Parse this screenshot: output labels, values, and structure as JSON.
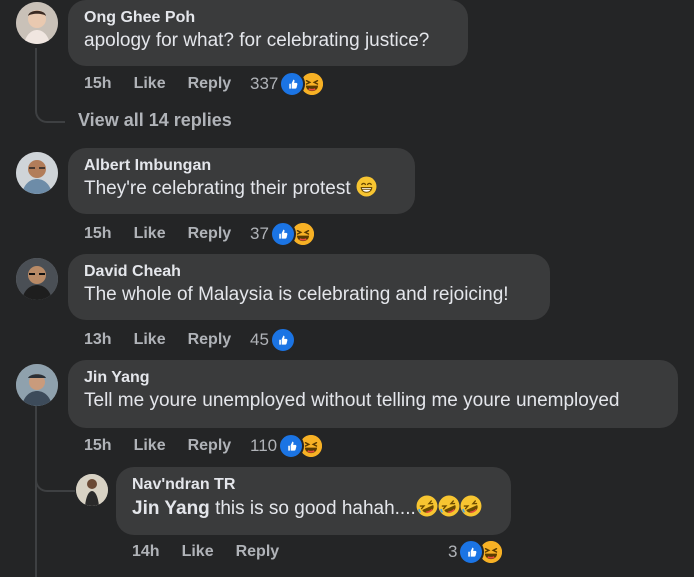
{
  "comments": [
    {
      "author": "Ong Ghee Poh",
      "text": "apology for what? for celebrating justice?",
      "time": "15h",
      "like_label": "Like",
      "reply_label": "Reply",
      "reaction_count": "337",
      "reactions": [
        "like-icon",
        "haha-icon"
      ]
    },
    {
      "author": "Albert Imbungan",
      "text": "They're celebrating their protest",
      "text_emoji": "grinning-face-icon",
      "time": "15h",
      "like_label": "Like",
      "reply_label": "Reply",
      "reaction_count": "37",
      "reactions": [
        "like-icon",
        "haha-icon"
      ]
    },
    {
      "author": "David Cheah",
      "text": "The whole of Malaysia is celebrating and rejoicing!",
      "time": "13h",
      "like_label": "Like",
      "reply_label": "Reply",
      "reaction_count": "45",
      "reactions": [
        "like-icon"
      ]
    },
    {
      "author": "Jin Yang",
      "text": "Tell me youre unemployed without telling me youre unemployed",
      "time": "15h",
      "like_label": "Like",
      "reply_label": "Reply",
      "reaction_count": "110",
      "reactions": [
        "like-icon",
        "haha-icon"
      ]
    }
  ],
  "view_replies": "View all 14 replies",
  "reply": {
    "author": "Nav'ndran TR",
    "mention": "Jin Yang",
    "text": " this is so good hahah....",
    "text_emojis": [
      "rolling-laughing-icon",
      "rolling-laughing-icon",
      "rolling-laughing-icon"
    ],
    "time": "14h",
    "like_label": "Like",
    "reply_label": "Reply",
    "reaction_count": "3",
    "reactions": [
      "like-icon",
      "haha-icon"
    ]
  },
  "colors": {
    "background": "#242526",
    "bubble": "#3a3b3c",
    "primary_text": "#e4e6eb",
    "secondary_text": "#b0b3b8",
    "like_blue": "#1b74e4",
    "haha_yellow": "#f7b125"
  }
}
